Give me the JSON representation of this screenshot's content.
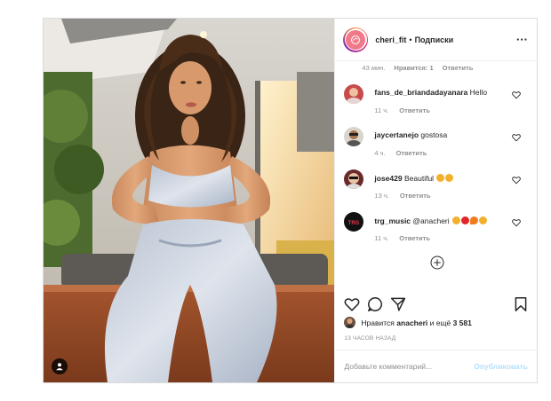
{
  "post": {
    "username": "cheri_fit",
    "dot": "•",
    "follow_label": "Подписки",
    "more_label": "···"
  },
  "top_comment_meta": {
    "time": "43 мин.",
    "likes": "Нравится: 1",
    "reply": "Ответить"
  },
  "comments": [
    {
      "user": "fans_de_briandadayanara",
      "text": "Hello",
      "time": "11 ч.",
      "reply": "Ответить"
    },
    {
      "user": "jaycertanejo",
      "text": "gostosa",
      "time": "4 ч.",
      "reply": "Ответить"
    },
    {
      "user": "jose429",
      "text": "Beautiful",
      "time": "13 ч.",
      "reply": "Ответить"
    },
    {
      "user": "trg_music",
      "text": "@anacheri",
      "time": "11 ч.",
      "reply": "Ответить"
    }
  ],
  "likes": {
    "prefix": "Нравится",
    "user": "anacheri",
    "middle": "и ещё",
    "count": "3 581"
  },
  "timestamp": "13 ЧАСОВ НАЗАД",
  "add_comment": {
    "placeholder": "Добавьте комментарий...",
    "publish_label": "Опубликовать"
  },
  "colors": {
    "text": "#262626",
    "secondary": "#8e8e8e",
    "publish_disabled": "#b2dffc",
    "border": "#dbdbdb"
  },
  "icons": [
    "tag-user-icon",
    "more-icon",
    "heart-icon",
    "comment-icon",
    "share-icon",
    "bookmark-icon",
    "add-circle-icon"
  ]
}
